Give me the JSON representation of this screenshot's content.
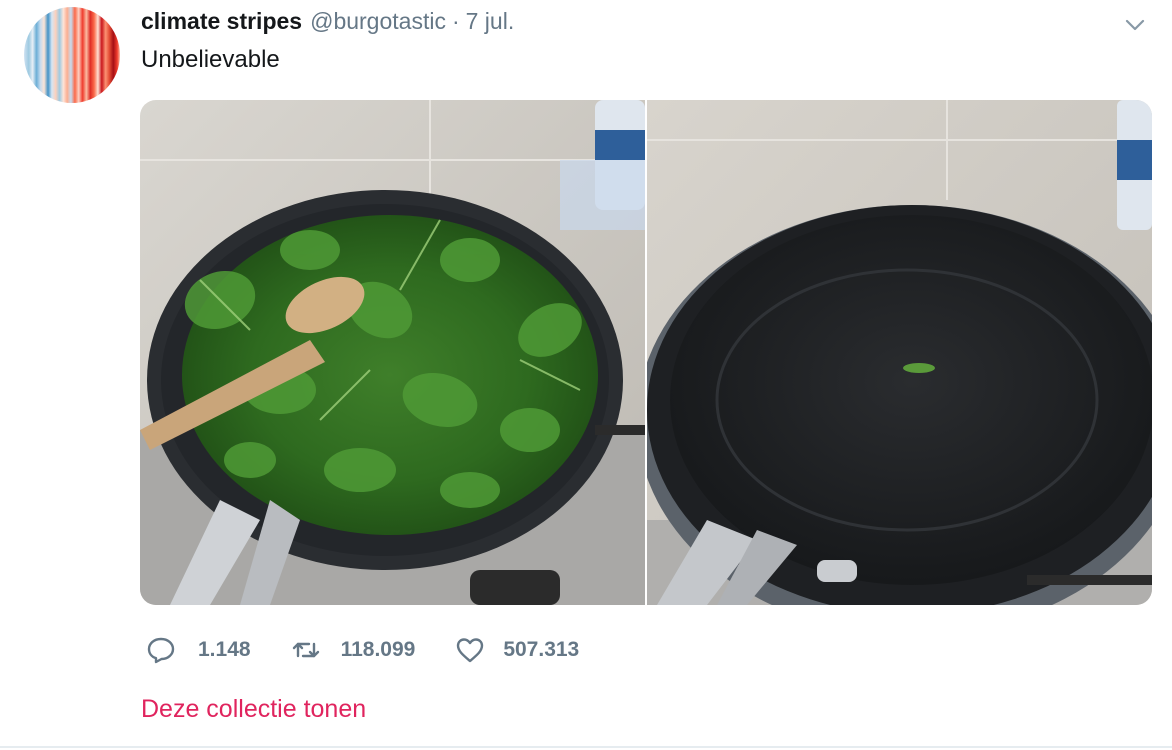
{
  "tweet": {
    "author_name": "climate stripes",
    "author_handle": "@burgotastic",
    "separator": "·",
    "date": "7 jul.",
    "text": "Unbelievable",
    "avatar_icon": "climate-stripes-avatar",
    "caret_icon": "chevron-down-icon",
    "media": [
      {
        "description_icon": "pan-full-of-spinach-photo"
      },
      {
        "description_icon": "empty-pan-photo"
      }
    ],
    "actions": {
      "reply_icon": "reply-icon",
      "reply_count": "1.148",
      "retweet_icon": "retweet-icon",
      "retweet_count": "118.099",
      "like_icon": "heart-icon",
      "like_count": "507.313"
    },
    "collection_link": "Deze collectie tonen"
  },
  "colors": {
    "text_primary": "#14171a",
    "text_secondary": "#657786",
    "link_accent": "#e0245e",
    "divider": "#e6ecf0"
  }
}
